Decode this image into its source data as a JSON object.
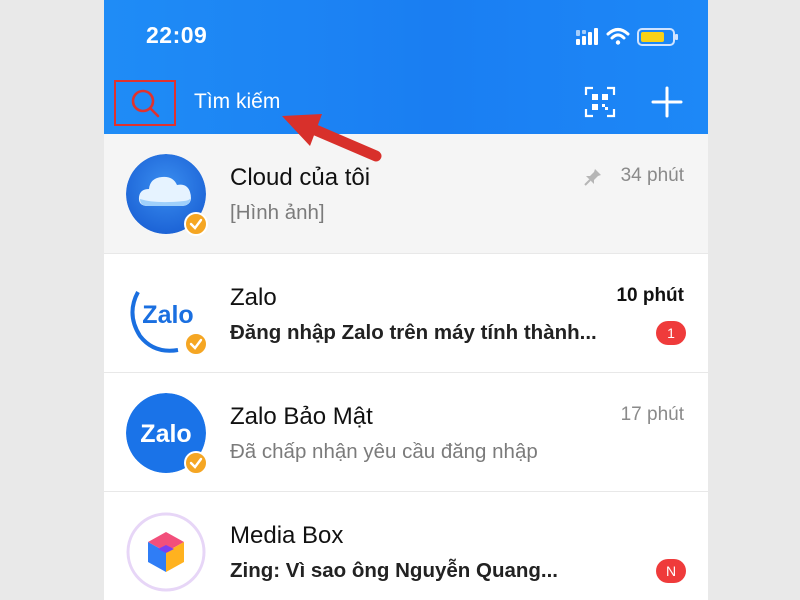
{
  "status_bar": {
    "time": "22:09",
    "icons": [
      "cellular-signal-icon",
      "wifi-icon",
      "battery-icon"
    ],
    "battery_color": "#f7d117"
  },
  "search_bar": {
    "icon": "search-icon",
    "label": "Tìm kiếm",
    "actions": [
      "qr-scan-icon",
      "plus-icon"
    ]
  },
  "colors": {
    "header": "#1a7ef2",
    "highlight_box": "#e0322e",
    "arrow": "#d8302b",
    "unread_badge": "#ef3b3b",
    "verified_badge": "#f5a623"
  },
  "conversations": [
    {
      "name": "Cloud của tôi",
      "preview": "[Hình ảnh]",
      "time": "34 phút",
      "pinned": true,
      "icon": "cloud-icon",
      "verified": true
    },
    {
      "name": "Zalo",
      "preview": "Đăng nhập Zalo trên máy tính thành...",
      "time": "10 phút",
      "badge": "1",
      "verified": true
    },
    {
      "name": "Zalo Bảo Mật",
      "preview": "Đã chấp nhận yêu cầu đăng nhập",
      "time": "17 phút",
      "verified": true
    },
    {
      "name": "Media Box",
      "preview": "Zing: Vì sao ông Nguyễn Quang...",
      "badge": "N",
      "icon": "media-box-icon"
    }
  ],
  "logos": {
    "zalo": "Zalo"
  }
}
